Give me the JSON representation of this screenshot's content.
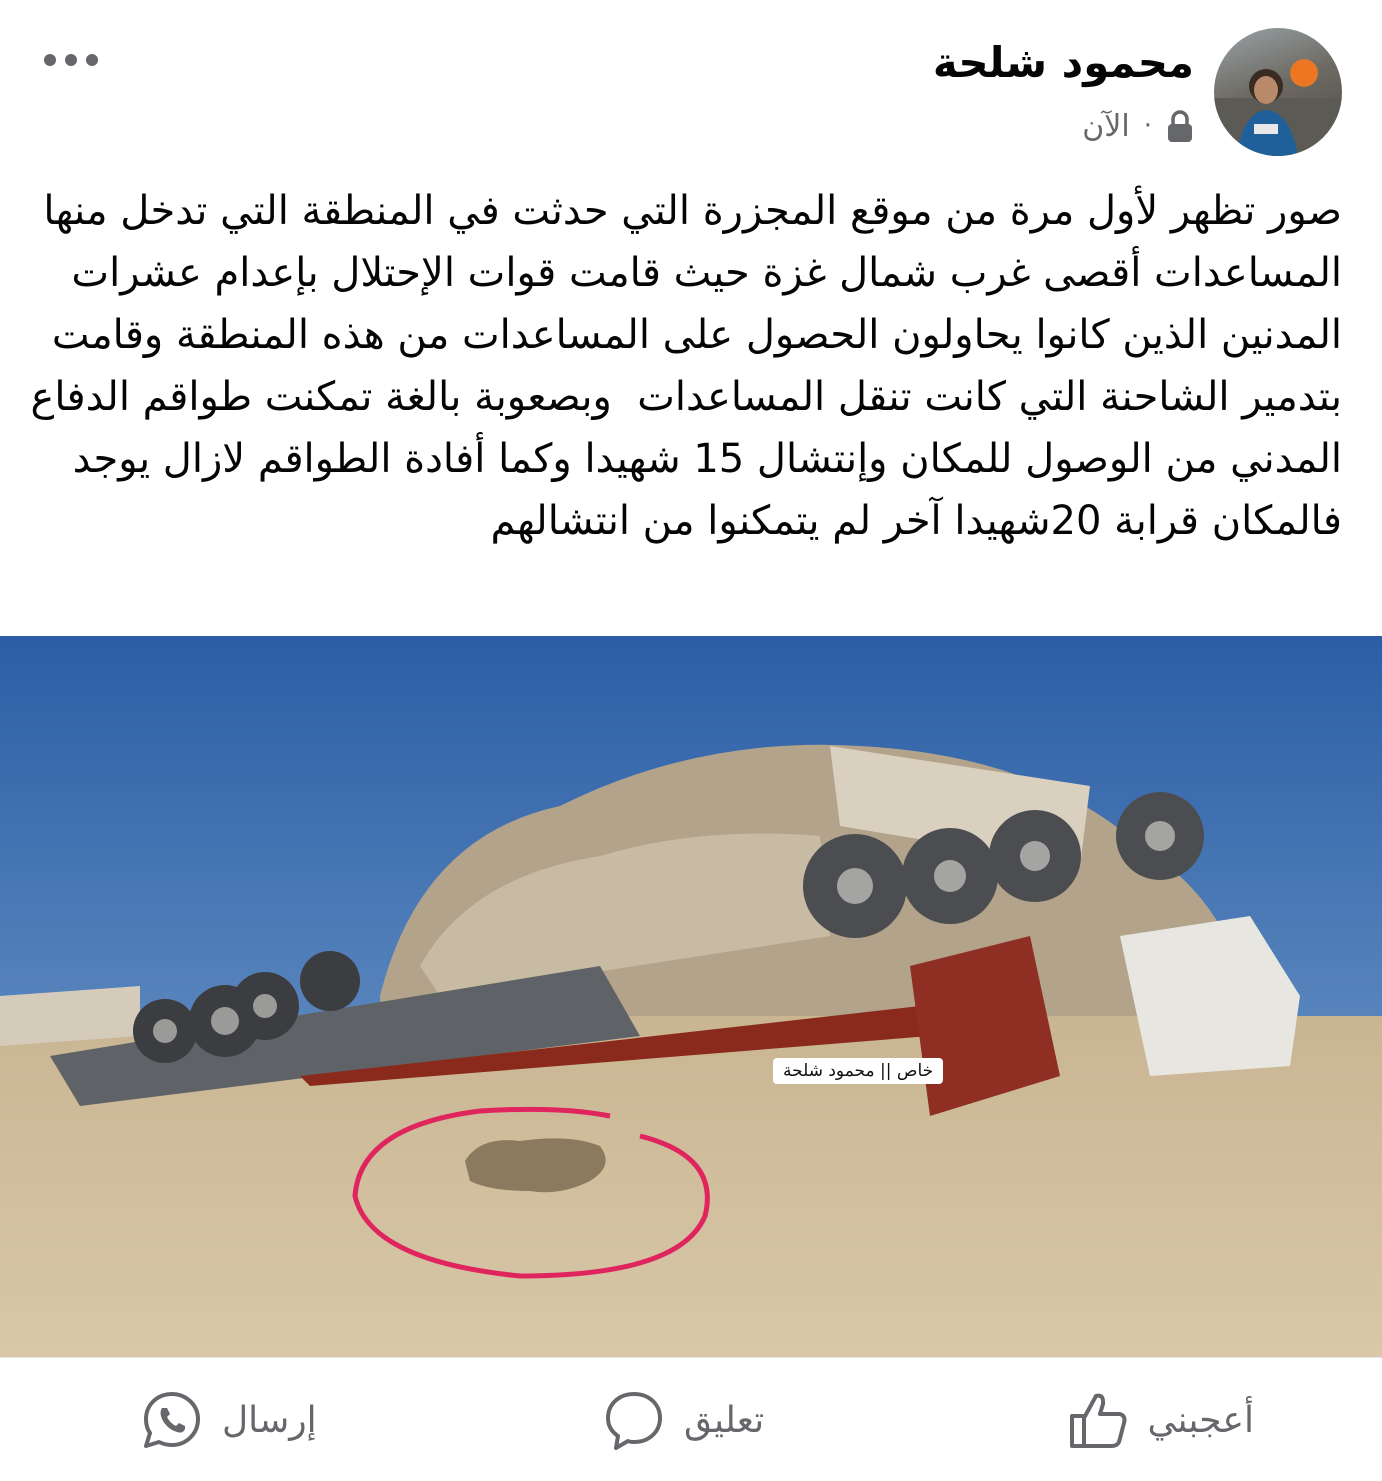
{
  "post": {
    "author": "محمود شلحة",
    "time": "الآن",
    "separator": "·",
    "privacy_icon": "lock-icon",
    "text": "صور تظهر لأول مرة من موقع المجزرة التي حدثت في المنطقة التي تدخل منها المساعدات أقصى غرب شمال غزة حيث قامت قوات الإحتلال بإعدام عشرات المدنين الذين كانوا يحاولون الحصول على المساعدات من هذه المنطقة وقامت بتدمير الشاحنة التي كانت تنقل المساعدات  وبصعوبة بالغة تمكنت طواقم الدفاع المدني من الوصول للمكان وإنتشال 15 شهيدا وكما أفادة الطواقم لازال يوجد فالمكان قرابة 20شهيدا آخر لم يتمكنوا من انتشالهم",
    "photo_watermark": "خاص || محمود شلحة"
  },
  "actions": {
    "like_label": "أعجبني",
    "comment_label": "تعليق",
    "share_label": "إرسال"
  },
  "colors": {
    "secondary_text": "#65676b",
    "annotation_circle": "#e0245e",
    "sky": "#2f64a8"
  }
}
